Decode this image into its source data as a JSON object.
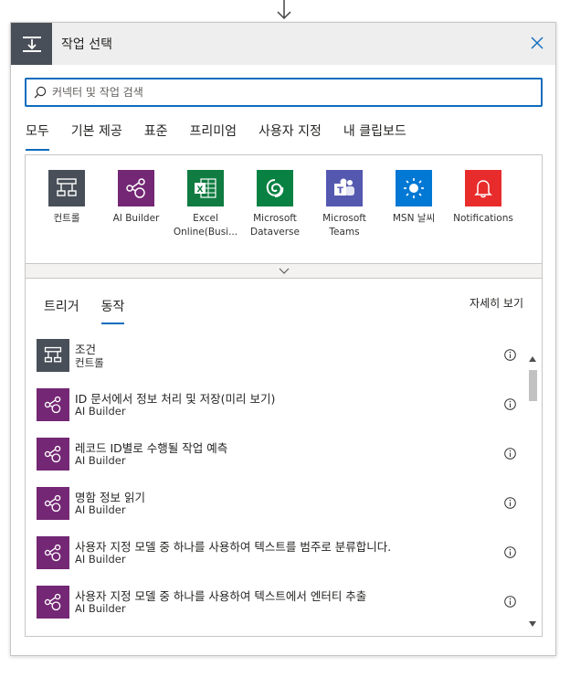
{
  "header": {
    "title": "작업 선택",
    "icon": "operation-icon"
  },
  "search": {
    "placeholder": "커넥터 및 작업 검색",
    "value": ""
  },
  "category_tabs": [
    {
      "label": "모두",
      "active": true
    },
    {
      "label": "기본 제공",
      "active": false
    },
    {
      "label": "표준",
      "active": false
    },
    {
      "label": "프리미엄",
      "active": false
    },
    {
      "label": "사용자 지정",
      "active": false
    },
    {
      "label": "내 클립보드",
      "active": false
    }
  ],
  "connectors": [
    {
      "label": "컨트롤",
      "icon": "control-icon",
      "color": "#484f58"
    },
    {
      "label": "AI Builder",
      "icon": "ai-builder-icon",
      "color": "#742774"
    },
    {
      "label": "Excel Online(Busi...",
      "icon": "excel-icon",
      "color": "#107c41"
    },
    {
      "label": "Microsoft Dataverse",
      "icon": "dataverse-icon",
      "color": "#088142"
    },
    {
      "label": "Microsoft Teams",
      "icon": "teams-icon",
      "color": "#5558af"
    },
    {
      "label": "MSN 날씨",
      "icon": "weather-icon",
      "color": "#0078d4"
    },
    {
      "label": "Notifications",
      "icon": "bell-icon",
      "color": "#e82c2c"
    }
  ],
  "sub_tabs": [
    {
      "label": "트리거",
      "active": false
    },
    {
      "label": "동작",
      "active": true
    }
  ],
  "see_more": "자세히 보기",
  "actions": [
    {
      "title": "조건",
      "connector": "컨트롤",
      "icon": "control-icon",
      "color": "#484f58"
    },
    {
      "title": "ID 문서에서 정보 처리 및 저장(미리 보기)",
      "connector": "AI Builder",
      "icon": "ai-builder-icon",
      "color": "#742774"
    },
    {
      "title": "레코드 ID별로 수행될 작업 예측",
      "connector": "AI Builder",
      "icon": "ai-builder-icon",
      "color": "#742774"
    },
    {
      "title": "명함 정보 읽기",
      "connector": "AI Builder",
      "icon": "ai-builder-icon",
      "color": "#742774"
    },
    {
      "title": "사용자 지정 모델 중 하나를 사용하여 텍스트를 범주로 분류합니다.",
      "connector": "AI Builder",
      "icon": "ai-builder-icon",
      "color": "#742774"
    },
    {
      "title": "사용자 지정 모델 중 하나를 사용하여 텍스트에서 엔터티 추출",
      "connector": "AI Builder",
      "icon": "ai-builder-icon",
      "color": "#742774"
    }
  ],
  "colors": {
    "accent": "#0f6cbd",
    "header_bg": "#eeeeee"
  }
}
